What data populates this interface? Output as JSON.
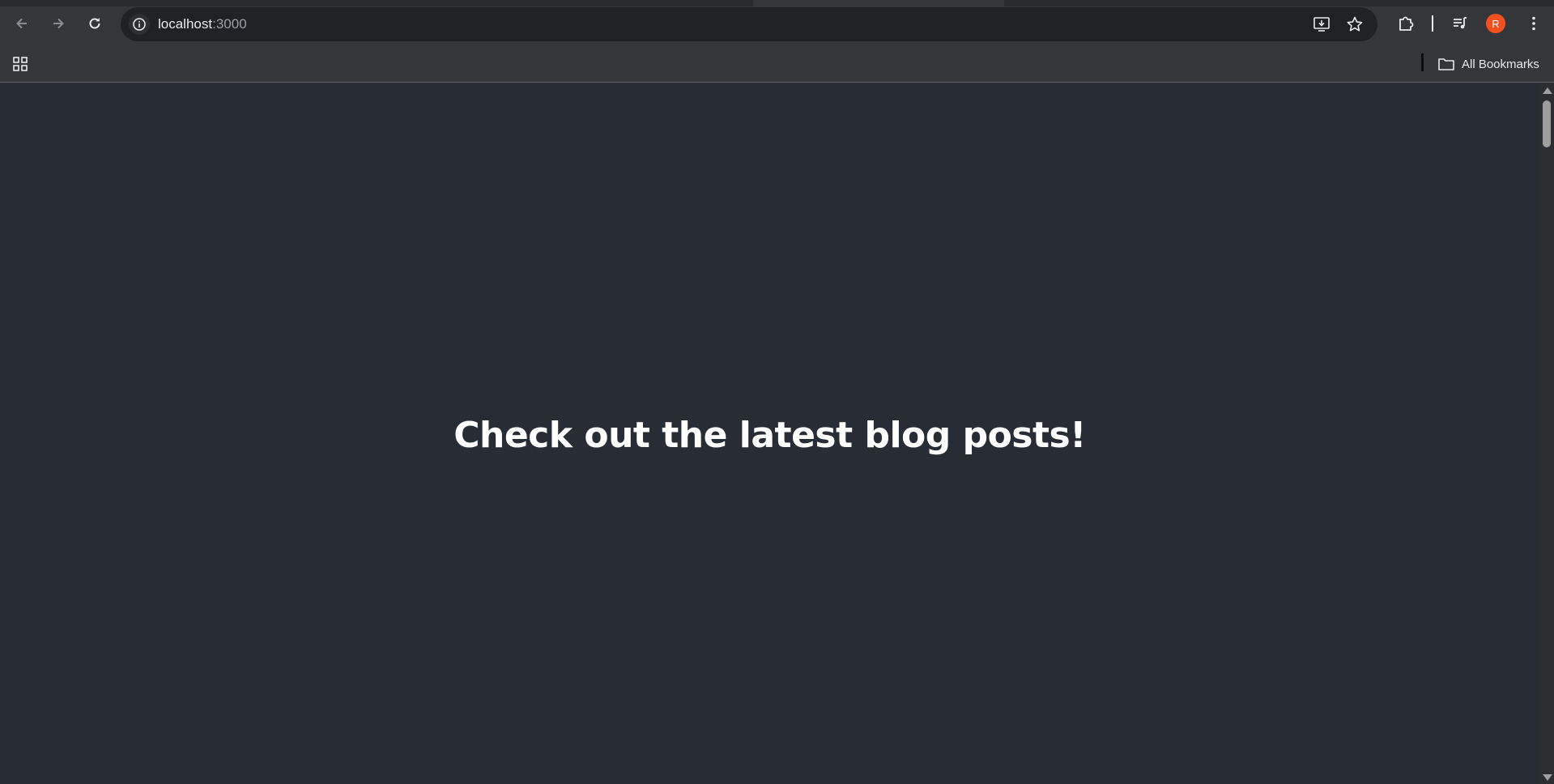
{
  "browser": {
    "url_host": "localhost",
    "url_port": ":3000",
    "profile_initial": "R",
    "profile_color": "#f4511e",
    "icons": {
      "back": "arrow-left-icon",
      "forward": "arrow-right-icon",
      "reload": "reload-icon",
      "site_info": "info-icon",
      "install": "install-app-icon",
      "bookmark": "star-icon",
      "extensions": "puzzle-icon",
      "media": "media-queue-icon",
      "menu": "kebab-menu-icon",
      "apps": "apps-grid-icon",
      "folder": "folder-icon"
    }
  },
  "bookmarks_bar": {
    "all_bookmarks_label": "All Bookmarks"
  },
  "page": {
    "background": "#282c34",
    "headline": "Check out the latest blog posts!"
  }
}
